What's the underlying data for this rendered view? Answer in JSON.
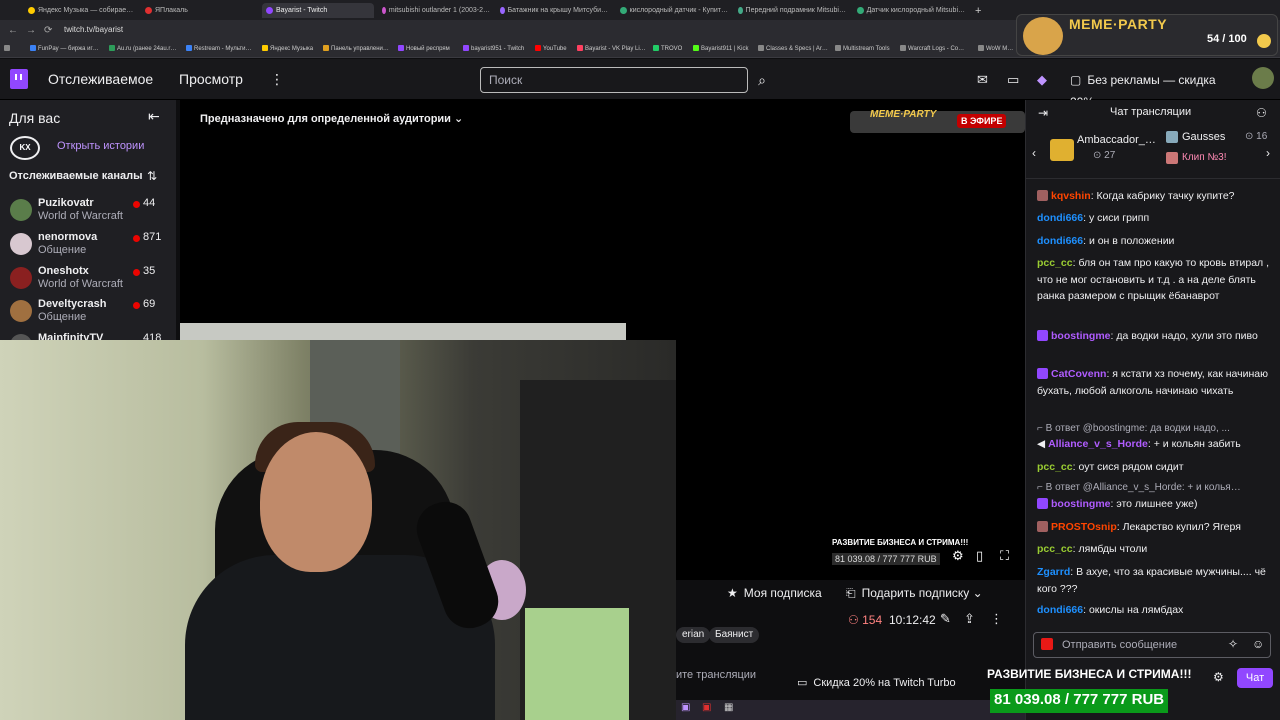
{
  "browser": {
    "tabs": [
      {
        "label": "Яндекс Музыка — собирае…",
        "color": "#ffcc00"
      },
      {
        "label": "ЯПлакаль",
        "color": "#e03030"
      },
      {
        "label": "Bayarist - Twitch",
        "color": "#9147ff",
        "active": true
      },
      {
        "label": "mitsubishi outlander 1 (2003-2…",
        "color": "#cc55cc"
      },
      {
        "label": "Батажник на крышу Митсуби…",
        "color": "#9966ff"
      },
      {
        "label": "кислородный датчик - Купит…",
        "color": "#33aa77"
      },
      {
        "label": "Передний подрамник Mitsubi…",
        "color": "#44aa88"
      },
      {
        "label": "Датчик кислородный Mitsubi…",
        "color": "#33aa77"
      }
    ],
    "url": "twitch.tv/bayarist",
    "bookmarks": [
      {
        "label": "FunPay — биржа иг…",
        "color": "#3b82f6"
      },
      {
        "label": "Au.ru (ранее 24au.r…",
        "color": "#2d9c5a"
      },
      {
        "label": "Restream - Мульти…",
        "color": "#3b82f6"
      },
      {
        "label": "Яндекс Музыка",
        "color": "#ffcc00"
      },
      {
        "label": "Панель управлени…",
        "color": "#e0a020"
      },
      {
        "label": "Новый респрям",
        "color": "#9147ff"
      },
      {
        "label": "bayarist951 - Twitch",
        "color": "#9147ff"
      },
      {
        "label": "YouTube",
        "color": "#ff0000"
      },
      {
        "label": "Bayarist - VK Play Li…",
        "color": "#ff4060"
      },
      {
        "label": "TROVO",
        "color": "#22cc66"
      },
      {
        "label": "Bayarist911 | Kick",
        "color": "#53fc18"
      },
      {
        "label": "Classes & Specs | Ar…",
        "color": "#888888"
      },
      {
        "label": "Multistream Tools",
        "color": "#888888"
      },
      {
        "label": "Warcraft Logs - Co…",
        "color": "#888888"
      },
      {
        "label": "WoW M…",
        "color": "#888888"
      }
    ]
  },
  "meme_party": {
    "title": "MEME·PARTY",
    "count": "54 / 100"
  },
  "topnav": {
    "following": "Отслеживаемое",
    "browse": "Просмотр",
    "search_placeholder": "Поиск",
    "promo": "Без рекламы — скидка 20%"
  },
  "sidebar": {
    "for_you": "Для вас",
    "stories_link": "Открыть истории",
    "followed_title": "Отслеживаемые каналы",
    "channels": [
      {
        "name": "Puzikovatr",
        "game": "World of Warcraft",
        "viewers": "44",
        "color": "#5a7d4a"
      },
      {
        "name": "nenormova",
        "game": "Общение",
        "viewers": "871",
        "color": "#d8c8d0"
      },
      {
        "name": "Oneshotx",
        "game": "World of Warcraft",
        "viewers": "35",
        "color": "#8a2020"
      },
      {
        "name": "Develtycrash",
        "game": "Общение",
        "viewers": "69",
        "color": "#a07040"
      },
      {
        "name": "MainfinityTV",
        "game": "",
        "viewers": "418",
        "color": "#555555"
      }
    ]
  },
  "player": {
    "audience_notice": "Предназначено для определенной аудитории",
    "live_badge": "В ЭФИРЕ",
    "overlay_title": "РАЗВИТИЕ БИЗНЕСА И СТРИМА!!!",
    "overlay_amount": "81 039.08 / 777 777 RUB"
  },
  "stream_info": {
    "subscribe": "Моя подписка",
    "gift": "Подарить подписку",
    "viewers": "154",
    "uptime": "10:12:42",
    "tags": [
      "erian",
      "Баянист"
    ],
    "about": "ите трансляции",
    "turbo": "Скидка 20% на Twitch Turbo"
  },
  "chat": {
    "title": "Чат трансляции",
    "gifters": [
      {
        "name": "Ambaccador_…",
        "count": "27"
      },
      {
        "name": "Gausses",
        "count": "16"
      }
    ],
    "clip_label": "Клип №3!",
    "messages": [
      {
        "user": "kqvshin",
        "color": "#ff4500",
        "text": "Когда кабрику тачку купите?",
        "badge": "#a06060"
      },
      {
        "user": "dondi666",
        "color": "#1e90ff",
        "text": "у сиси грипп"
      },
      {
        "user": "dondi666",
        "color": "#1e90ff",
        "text": "и он в положении"
      },
      {
        "user": "pcc_cc",
        "color": "#9acd32",
        "text": "бля он там про какую то кровь втирал , что не мог остановить и т.д . а на деле блять ранка размером с прыщик ёбанаврот"
      },
      {
        "user": "boostingme",
        "color": "#b05cff",
        "text": "да водки надо, хули это пиво",
        "badge": "#9147ff"
      },
      {
        "user": "CatCovenn",
        "color": "#b05cff",
        "text": "я кстати хз почему, как начинаю бухать, любой алкоголь начинаю чихать",
        "badge": "#9147ff"
      }
    ],
    "reply1": "В ответ @boostingme: да водки надо, ...",
    "msg_alliance": {
      "user": "Alliance_v_s_Horde",
      "color": "#b05cff",
      "text": "+ и кольян забить"
    },
    "msg_pcc2": {
      "user": "pcc_cc",
      "color": "#9acd32",
      "text": "оут сися рядом сидит"
    },
    "reply2": "В ответ @Alliance_v_s_Horde: + и колья…",
    "msg_boost2": {
      "user": "boostingme",
      "color": "#b05cff",
      "text": "это лишнее уже)"
    },
    "msg_prosto": {
      "user": "PROSTOsnip",
      "color": "#ff4500",
      "text": "Лекарство купил? Ягеря"
    },
    "msg_pcc3": {
      "user": "pcc_cc",
      "color": "#9acd32",
      "text": "лямбды чтоли"
    },
    "msg_zgarrd": {
      "user": "Zgarrd",
      "color": "#1e90ff",
      "text": "В ахуе, что за красивые мужчины.... чё кого ???"
    },
    "msg_dondi3": {
      "user": "dondi666",
      "color": "#1e90ff",
      "text": "окислы на лямбдах"
    },
    "input_placeholder": "Отправить сообщение",
    "chat_button": "Чат",
    "overlay_title": "РАЗВИТИЕ БИЗНЕСА И СТРИМА!!!",
    "overlay_amount": "81 039.08 / 777 777 RUB",
    "overlay_progress": 0.104
  }
}
